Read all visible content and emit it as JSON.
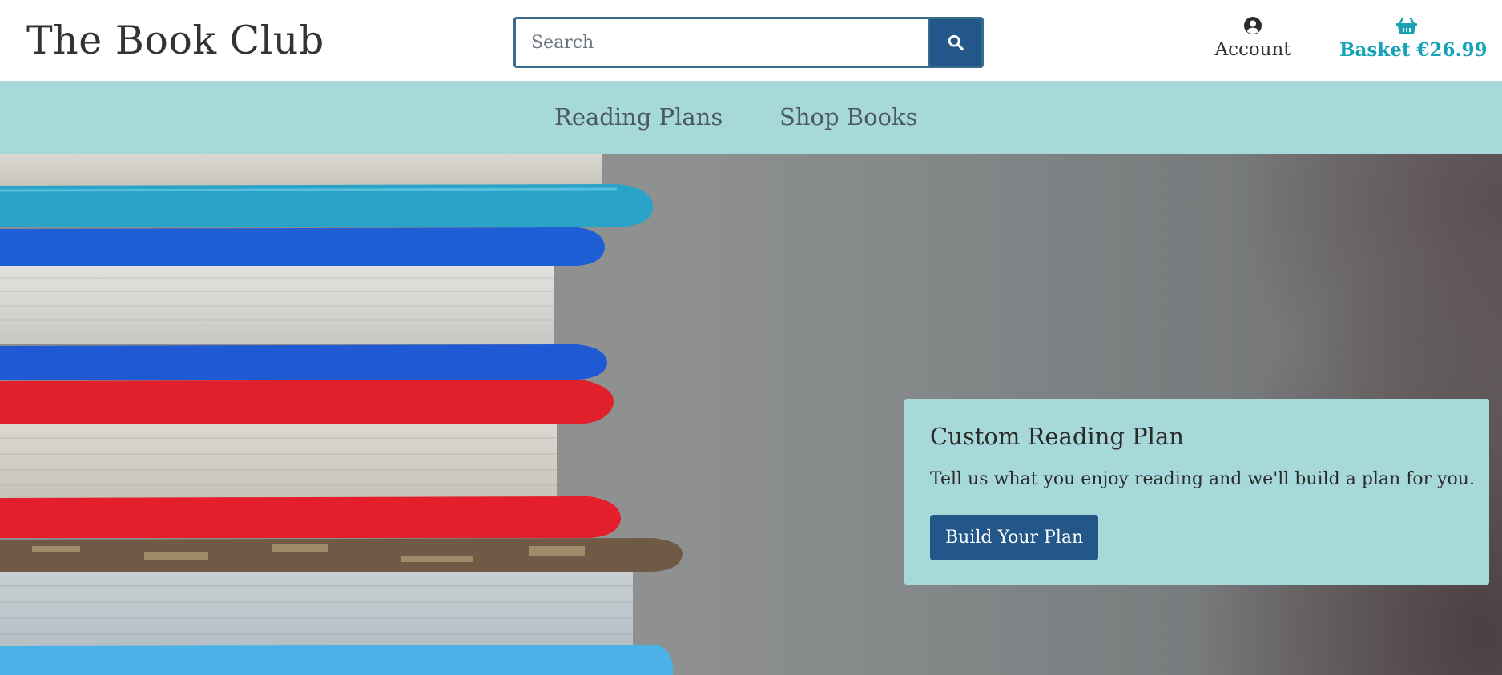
{
  "header": {
    "brand": "The Book Club",
    "search": {
      "placeholder": "Search",
      "value": "",
      "button_icon": "search-icon"
    },
    "account": {
      "label": "Account",
      "icon": "user-circle-icon"
    },
    "basket": {
      "label": "Basket €26.99",
      "icon": "shopping-basket-icon"
    }
  },
  "nav": {
    "items": [
      {
        "label": "Reading Plans"
      },
      {
        "label": "Shop Books"
      }
    ]
  },
  "hero": {
    "image": "stack-of-books-image",
    "promo": {
      "title": "Custom Reading Plan",
      "text": "Tell us what you enjoy reading and we'll build a plan for you.",
      "button_label": "Build Your Plan"
    }
  },
  "colors": {
    "nav_background": "#a8d9da",
    "primary_button": "#23578a",
    "basket_accent": "#17a2b8",
    "search_border": "#3a6a8c"
  }
}
